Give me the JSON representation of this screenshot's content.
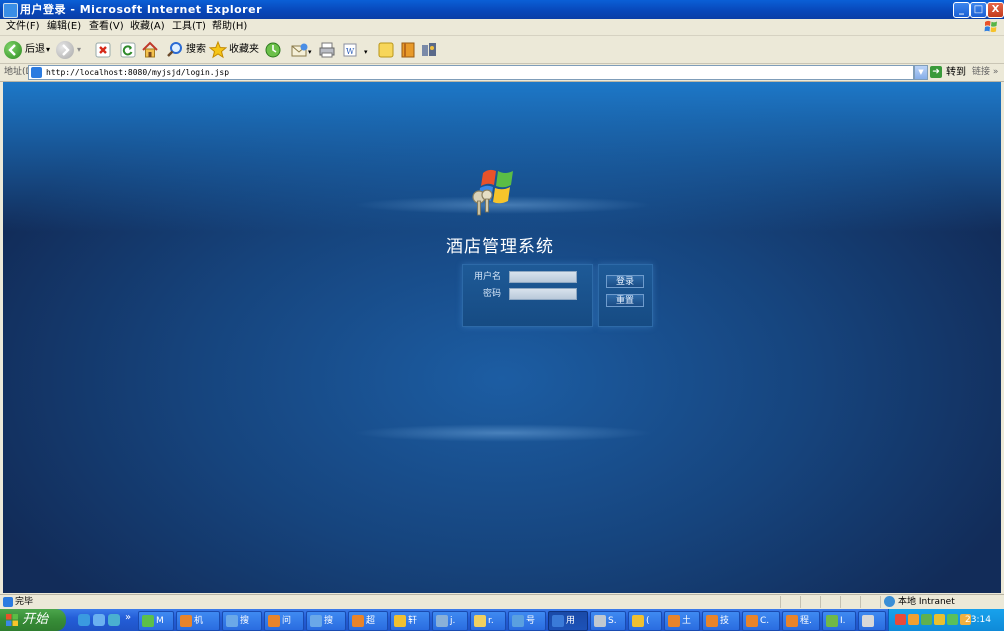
{
  "window": {
    "title": "用户登录 - Microsoft Internet Explorer",
    "controls": {
      "minimize": "_",
      "maximize": "□",
      "close": "X"
    }
  },
  "menu": [
    "文件(F)",
    "编辑(E)",
    "查看(V)",
    "收藏(A)",
    "工具(T)",
    "帮助(H)"
  ],
  "toolbar": {
    "back": "后退",
    "search": "搜索",
    "favorites": "收藏夹"
  },
  "address": {
    "label": "地址(D)",
    "url": "http://localhost:8080/myjsjd/login.jsp",
    "go": "转到",
    "links": "链接 »"
  },
  "page": {
    "system_title": "酒店管理系统",
    "username_label": "用户名",
    "password_label": "密码",
    "login_button": "登录",
    "reset_button": "重置"
  },
  "status": {
    "text": "完毕",
    "zone": "本地 Intranet"
  },
  "taskbar": {
    "start": "开始",
    "more": "»",
    "tasks": [
      "M",
      "机",
      "搜",
      "问",
      "搜",
      "超",
      "轩",
      "j.",
      "r.",
      "号",
      "用",
      "S.",
      "(",
      "土",
      "技",
      "C.",
      "程.",
      "I.",
      ""
    ],
    "clock": "23:14"
  },
  "colors": {
    "titlebar": "#0846b8",
    "page_bg": "#16447d",
    "panel_border": "#2d6aa8",
    "taskbar": "#245ed8",
    "start": "#388e38"
  }
}
